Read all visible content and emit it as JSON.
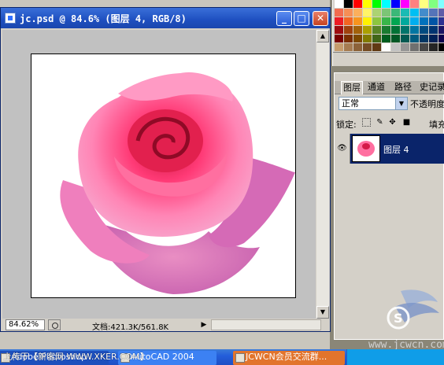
{
  "document": {
    "title": "jc.psd @ 84.6% (图层 4, RGB/8)",
    "zoom": "84.62%",
    "doc_info": "文档:421.3K/561.8K",
    "controls": {
      "minimize": "_",
      "maximize": "□",
      "close": "✕"
    }
  },
  "layers_panel": {
    "tabs": [
      "图层",
      "通道",
      "路径",
      "史记录"
    ],
    "blend_mode": "正常",
    "opacity_label": "不透明度",
    "lock_label": "锁定:",
    "fill_label": "填充",
    "layer": {
      "name": "图层 4",
      "visible_icon": "eye-icon"
    }
  },
  "taskbar": {
    "items": [
      "Adobe Photoshop",
      "AutoCAD 2004",
      "JCWCN会员交流群..."
    ]
  },
  "watermarks": {
    "top": "上传于【新客网 WWW.XKER.COM】",
    "site": "www.jcwcn.com"
  },
  "swatch_colors": [
    "#ffffff",
    "#000000",
    "#ff0000",
    "#ffff00",
    "#00ff00",
    "#00ffff",
    "#0000ff",
    "#ff00ff",
    "#ff8080",
    "#ffff80",
    "#80ff80",
    "#80ffff",
    "#f26c4f",
    "#f68e56",
    "#fbaf5c",
    "#fff467",
    "#acd372",
    "#7cc576",
    "#3bb878",
    "#1abbb4",
    "#00bff3",
    "#438ccb",
    "#5574b9",
    "#605ca8",
    "#ed1c24",
    "#f26522",
    "#f7941d",
    "#fff200",
    "#8dc63f",
    "#39b54a",
    "#00a651",
    "#00a99d",
    "#00aeef",
    "#0072bc",
    "#0054a6",
    "#2e3192",
    "#9e0b0f",
    "#a0410d",
    "#a3620a",
    "#aba000",
    "#598527",
    "#197b30",
    "#007236",
    "#00746b",
    "#0076a3",
    "#004b80",
    "#003471",
    "#1b1464",
    "#790000",
    "#7b2e00",
    "#7d4900",
    "#827b00",
    "#406618",
    "#005e20",
    "#005826",
    "#005952",
    "#005b7f",
    "#003663",
    "#002157",
    "#0d004c",
    "#c69c6d",
    "#a67c52",
    "#8c6239",
    "#754c24",
    "#603913",
    "#ffffff",
    "#c2c2c2",
    "#959595",
    "#707070",
    "#464646",
    "#252525",
    "#000000"
  ]
}
